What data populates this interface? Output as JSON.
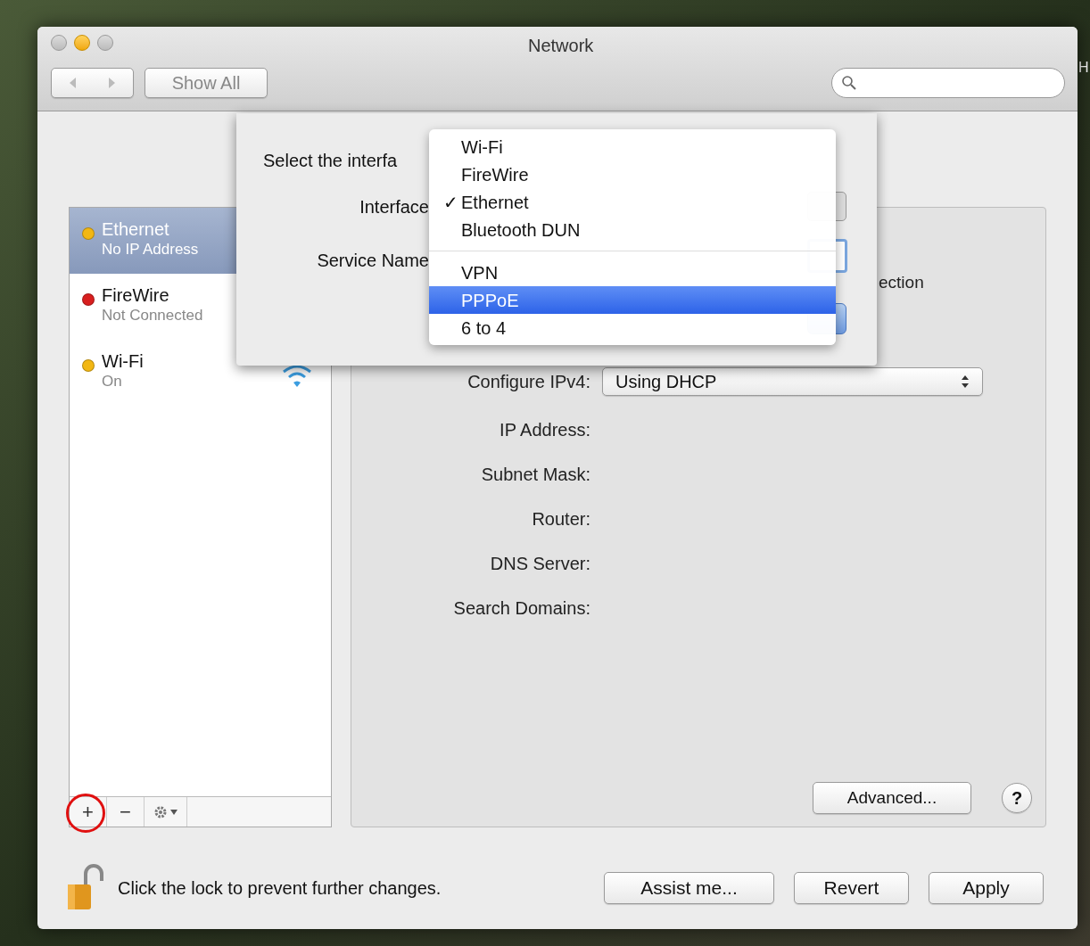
{
  "window": {
    "title": "Network"
  },
  "desktop_text": "H",
  "toolbar": {
    "show_all": "Show All"
  },
  "sidebar": {
    "services": [
      {
        "name": "Ethernet",
        "status": "No IP Address",
        "color": "#f2b713",
        "selected": true
      },
      {
        "name": "FireWire",
        "status": "Not Connected",
        "color": "#d81f1f",
        "selected": false
      },
      {
        "name": "Wi-Fi",
        "status": "On",
        "color": "#f2b713",
        "selected": false
      }
    ],
    "add_label": "+",
    "remove_label": "−"
  },
  "panel": {
    "partial_text": "ection",
    "configure": {
      "label": "Configure IPv4:",
      "value": "Using DHCP"
    },
    "fields": [
      "IP Address:",
      "Subnet Mask:",
      "Router:",
      "DNS Server:",
      "Search Domains:"
    ],
    "advanced": "Advanced...",
    "help": "?"
  },
  "sheet": {
    "prompt": "Select the interfa",
    "interface_label": "Interface",
    "service_name_label": "Service Name"
  },
  "menu": {
    "groups": [
      [
        {
          "label": "Wi-Fi",
          "checked": false,
          "selected": false
        },
        {
          "label": "FireWire",
          "checked": false,
          "selected": false
        },
        {
          "label": "Ethernet",
          "checked": true,
          "selected": false
        },
        {
          "label": "Bluetooth DUN",
          "checked": false,
          "selected": false
        }
      ],
      [
        {
          "label": "VPN",
          "checked": false,
          "selected": false
        },
        {
          "label": "PPPoE",
          "checked": false,
          "selected": true
        },
        {
          "label": "6 to 4",
          "checked": false,
          "selected": false
        }
      ]
    ],
    "check_mark": "✓"
  },
  "footer": {
    "lock_text": "Click the lock to prevent further changes.",
    "buttons": [
      "Assist me...",
      "Revert",
      "Apply"
    ]
  }
}
